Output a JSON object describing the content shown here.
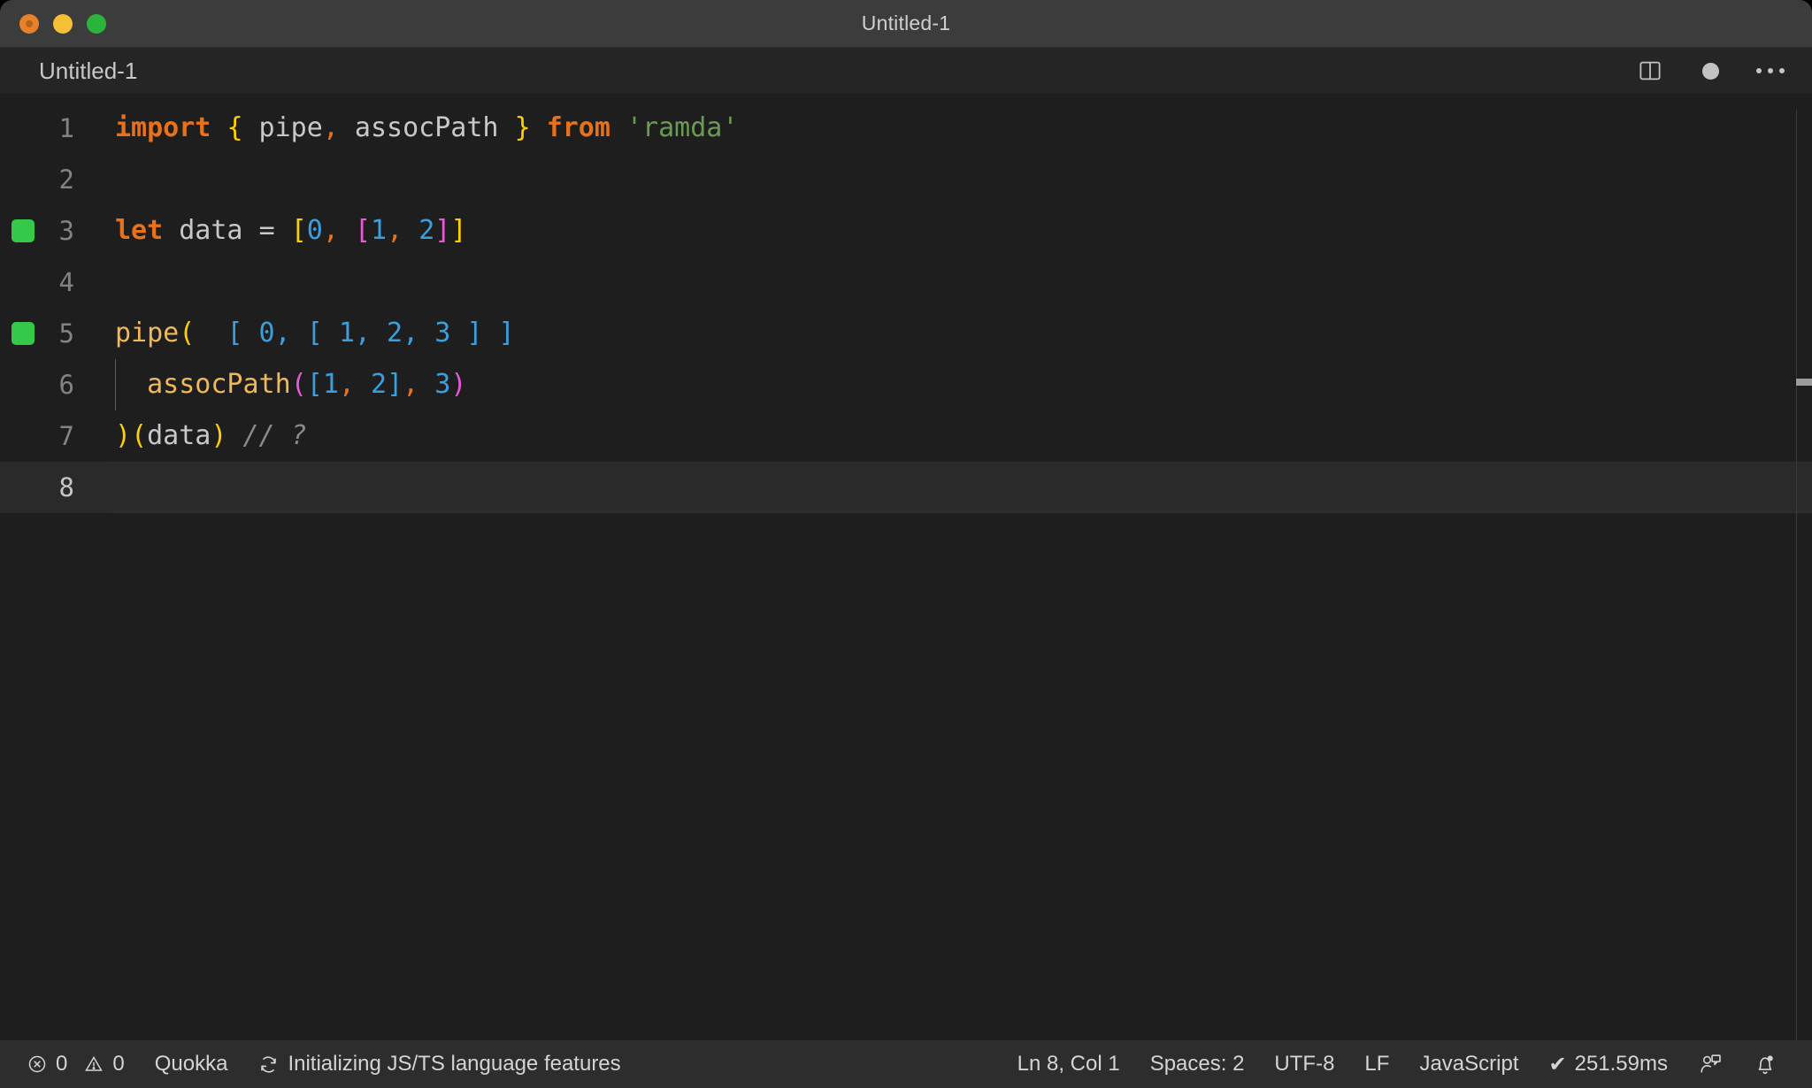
{
  "window": {
    "title": "Untitled-1",
    "traffic_lights": [
      "close",
      "minimize",
      "maximize"
    ],
    "colors": {
      "close": "#e8822a",
      "minimize": "#f5c033",
      "maximize": "#2bb43b",
      "titlebar_bg": "#3c3c3c",
      "editor_bg": "#1e1e1e",
      "statusbar_bg": "#2d2d2d",
      "quokka_marker": "#35c94a",
      "quokka_inline_value": "#3a9fe0"
    }
  },
  "tab": {
    "label": "Untitled-1",
    "actions": {
      "split_editor": "split-editor-icon",
      "unsaved_dot": "unsaved-dot-icon",
      "more": "more-actions-icon"
    }
  },
  "editor": {
    "language": "JavaScript",
    "lines": [
      {
        "number": "1",
        "marker": false,
        "active": false,
        "indent_guide": false,
        "tokens": [
          {
            "text": "import",
            "cls": "t-kw"
          },
          {
            "text": " ",
            "cls": "t-var"
          },
          {
            "text": "{",
            "cls": "t-b1"
          },
          {
            "text": " pipe",
            "cls": "t-var"
          },
          {
            "text": ",",
            "cls": "t-punc"
          },
          {
            "text": " assocPath ",
            "cls": "t-var"
          },
          {
            "text": "}",
            "cls": "t-b1"
          },
          {
            "text": " ",
            "cls": "t-var"
          },
          {
            "text": "from",
            "cls": "t-kw"
          },
          {
            "text": " ",
            "cls": "t-var"
          },
          {
            "text": "'ramda'",
            "cls": "t-str"
          }
        ]
      },
      {
        "number": "2",
        "marker": false,
        "active": false,
        "indent_guide": false,
        "tokens": []
      },
      {
        "number": "3",
        "marker": true,
        "active": false,
        "indent_guide": false,
        "tokens": [
          {
            "text": "let",
            "cls": "t-kw"
          },
          {
            "text": " data ",
            "cls": "t-var"
          },
          {
            "text": "=",
            "cls": "t-op"
          },
          {
            "text": " ",
            "cls": "t-var"
          },
          {
            "text": "[",
            "cls": "t-b1"
          },
          {
            "text": "0",
            "cls": "t-num"
          },
          {
            "text": ",",
            "cls": "t-punc"
          },
          {
            "text": " ",
            "cls": "t-var"
          },
          {
            "text": "[",
            "cls": "t-b2"
          },
          {
            "text": "1",
            "cls": "t-num"
          },
          {
            "text": ",",
            "cls": "t-punc"
          },
          {
            "text": " ",
            "cls": "t-var"
          },
          {
            "text": "2",
            "cls": "t-num"
          },
          {
            "text": "]",
            "cls": "t-b2"
          },
          {
            "text": "]",
            "cls": "t-b1"
          }
        ]
      },
      {
        "number": "4",
        "marker": false,
        "active": false,
        "indent_guide": false,
        "tokens": []
      },
      {
        "number": "5",
        "marker": true,
        "active": false,
        "indent_guide": false,
        "tokens": [
          {
            "text": "pipe",
            "cls": "t-fn"
          },
          {
            "text": "(",
            "cls": "t-b1"
          },
          {
            "text": "  ",
            "cls": "t-var"
          },
          {
            "text": "[ 0, [ 1, 2, 3 ] ]",
            "cls": "t-quokka"
          }
        ]
      },
      {
        "number": "6",
        "marker": false,
        "active": false,
        "indent_guide": true,
        "tokens": [
          {
            "text": "  ",
            "cls": "t-var"
          },
          {
            "text": "assocPath",
            "cls": "t-fn"
          },
          {
            "text": "(",
            "cls": "t-b2"
          },
          {
            "text": "[",
            "cls": "t-b3"
          },
          {
            "text": "1",
            "cls": "t-num"
          },
          {
            "text": ",",
            "cls": "t-punc"
          },
          {
            "text": " ",
            "cls": "t-var"
          },
          {
            "text": "2",
            "cls": "t-num"
          },
          {
            "text": "]",
            "cls": "t-b3"
          },
          {
            "text": ",",
            "cls": "t-punc"
          },
          {
            "text": " ",
            "cls": "t-var"
          },
          {
            "text": "3",
            "cls": "t-num"
          },
          {
            "text": ")",
            "cls": "t-b2"
          }
        ]
      },
      {
        "number": "7",
        "marker": false,
        "active": false,
        "indent_guide": false,
        "tokens": [
          {
            "text": ")",
            "cls": "t-b1"
          },
          {
            "text": "(",
            "cls": "t-b1"
          },
          {
            "text": "data",
            "cls": "t-var"
          },
          {
            "text": ")",
            "cls": "t-b1"
          },
          {
            "text": " ",
            "cls": "t-var"
          },
          {
            "text": "// ?",
            "cls": "t-comment"
          }
        ]
      },
      {
        "number": "8",
        "marker": false,
        "active": true,
        "indent_guide": false,
        "tokens": []
      }
    ]
  },
  "statusbar": {
    "errors": "0",
    "warnings": "0",
    "quokka": "Quokka",
    "task": "Initializing JS/TS language features",
    "cursor": "Ln 8, Col 1",
    "indentation": "Spaces: 2",
    "encoding": "UTF-8",
    "eol": "LF",
    "language": "JavaScript",
    "runtime": "251.59ms",
    "runtime_check": "✔",
    "feedback_icon": "feedback-person-icon",
    "notifications_icon": "bell-icon"
  }
}
